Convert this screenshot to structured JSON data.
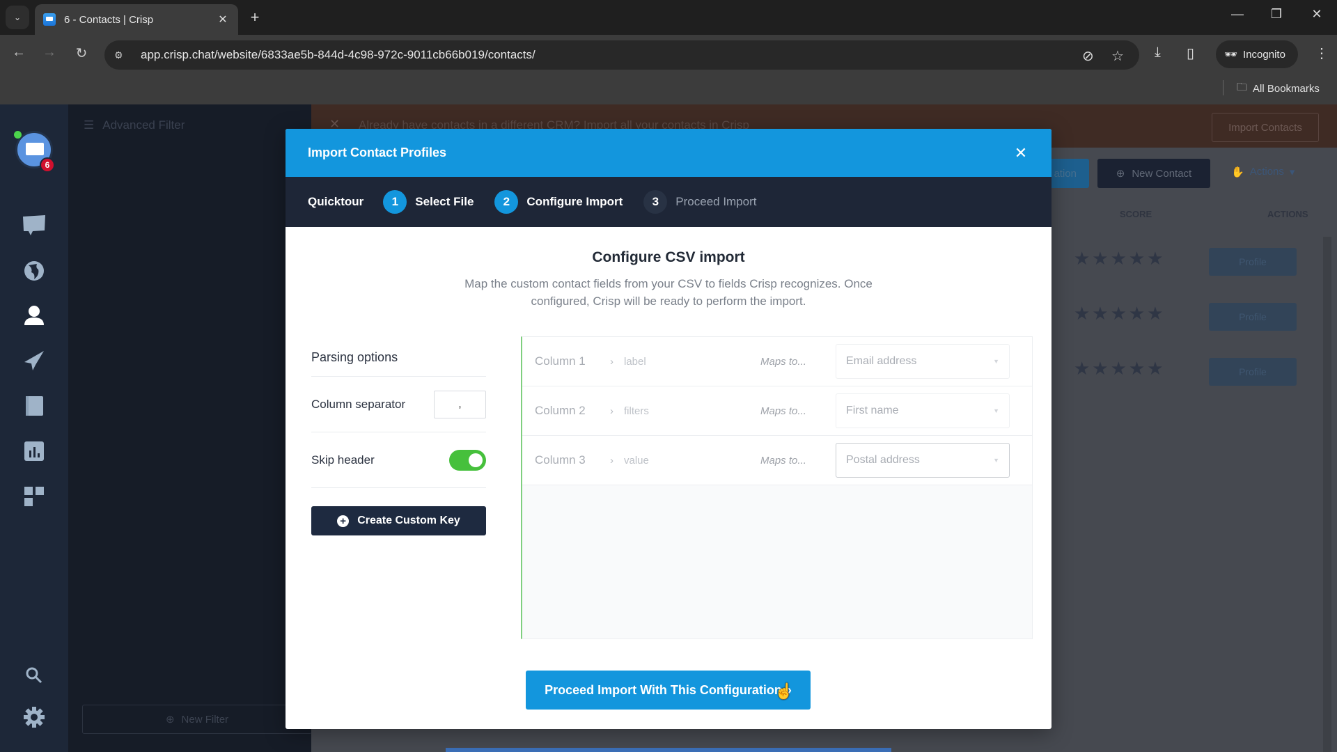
{
  "browser": {
    "tab_title": "6 - Contacts | Crisp",
    "url": "app.crisp.chat/website/6833ae5b-844d-4c98-972c-9011cb66b019/contacts/",
    "incognito_label": "Incognito",
    "bookmarks_label": "All Bookmarks"
  },
  "sidebar": {
    "unread_badge": "6",
    "items": [
      {
        "name": "inbox",
        "icon": "chat-bubble-icon"
      },
      {
        "name": "visitors",
        "icon": "globe-icon"
      },
      {
        "name": "contacts",
        "icon": "user-icon",
        "active": true
      },
      {
        "name": "campaigns",
        "icon": "paper-plane-icon"
      },
      {
        "name": "helpdesk",
        "icon": "book-icon"
      },
      {
        "name": "analytics",
        "icon": "bar-chart-icon"
      },
      {
        "name": "plugins",
        "icon": "grid-icon"
      }
    ],
    "bottom": [
      {
        "name": "search",
        "icon": "search-icon"
      },
      {
        "name": "settings",
        "icon": "gear-icon"
      }
    ]
  },
  "filter_panel": {
    "title": "Advanced Filter",
    "new_filter_label": "New Filter"
  },
  "background": {
    "banner_text": "Already have contacts in a different CRM? Import all your contacts in Crisp",
    "banner_button": "Import Contacts",
    "integration_button": "ation",
    "new_contact_button": "New Contact",
    "actions_button": "Actions",
    "columns": {
      "score": "SCORE",
      "actions": "ACTIONS"
    },
    "rows": [
      {
        "stars": "★★★★★",
        "action": "Profile"
      },
      {
        "stars": "★★★★★",
        "action": "Profile"
      },
      {
        "stars": "★★★★★",
        "action": "Profile"
      }
    ]
  },
  "modal": {
    "title": "Import Contact Profiles",
    "quicktour_label": "Quicktour",
    "steps": [
      {
        "number": "1",
        "label": "Select File",
        "state": "done"
      },
      {
        "number": "2",
        "label": "Configure Import",
        "state": "active"
      },
      {
        "number": "3",
        "label": "Proceed Import",
        "state": "pending"
      }
    ],
    "heading": "Configure CSV import",
    "description": "Map the custom contact fields from your CSV to fields Crisp recognizes. Once configured, Crisp will be ready to perform the import.",
    "parsing": {
      "title": "Parsing options",
      "separator_label": "Column separator",
      "separator_value": ",",
      "skip_header_label": "Skip header",
      "skip_header_enabled": true,
      "create_key_label": "Create Custom Key"
    },
    "mappings": [
      {
        "column": "Column 1",
        "key": "label",
        "maps_to_label": "Maps to...",
        "field": "Email address"
      },
      {
        "column": "Column 2",
        "key": "filters",
        "maps_to_label": "Maps to...",
        "field": "First name"
      },
      {
        "column": "Column 3",
        "key": "value",
        "maps_to_label": "Maps to...",
        "field": "Postal address"
      }
    ],
    "proceed_label": "Proceed Import With This Configuration"
  },
  "colors": {
    "brand_blue": "#1396dd",
    "dark_navy": "#1e2637",
    "toggle_green": "#46c03c",
    "badge_red": "#d0102e"
  }
}
